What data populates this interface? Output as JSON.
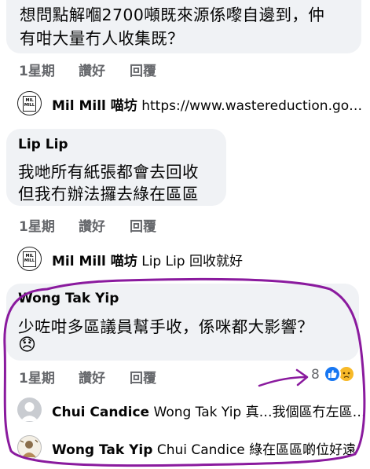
{
  "comments": [
    {
      "lines": [
        "想問點解嗰2700噸既來源係嚟自邊到，仲",
        "有咁大量冇人收集既？"
      ],
      "actions": {
        "time": "1星期",
        "like": "讚好",
        "reply": "回覆"
      },
      "reply": {
        "author": "Mil Mill 喵坊",
        "text": "https://www.wastereduction.gov.hk/zh-hk",
        "logo_text": "MIL MILL"
      }
    },
    {
      "author": "Lip Lip",
      "lines": [
        "我哋所有紙張都會去回收",
        "但我冇辦法攞去綠在區區"
      ],
      "actions": {
        "time": "1星期",
        "like": "讚好",
        "reply": "回覆"
      },
      "reply": {
        "author": "Mil Mill 喵坊",
        "text": "Lip Lip 回收就好",
        "logo_text": "MIL MILL"
      }
    },
    {
      "author": "Wong Tak Yip",
      "lines": [
        "少咗咁多區議員幫手收，係咪都大影響？",
        "😞"
      ],
      "actions": {
        "time": "1星期",
        "like": "讚好",
        "reply": "回覆"
      },
      "reaction_count": "8",
      "reaction_icons": [
        "like-icon",
        "sad-icon"
      ],
      "replies": [
        {
          "author": "Chui Candice",
          "text": "Wong Tak Yip 真…我個區冇左區議員",
          "avatar": "default-avatar-icon"
        },
        {
          "author": "Wong Tak Yip",
          "text": "Chui Candice 綠在區區啲位好遠",
          "avatar": "user-avatar-icon"
        }
      ]
    }
  ],
  "colors": {
    "bubble": "#f0f2f5",
    "meta": "#65676b",
    "annotation": "#8a1a9e",
    "like_blue": "#1877f2",
    "sad_yellow": "#f7b928"
  }
}
